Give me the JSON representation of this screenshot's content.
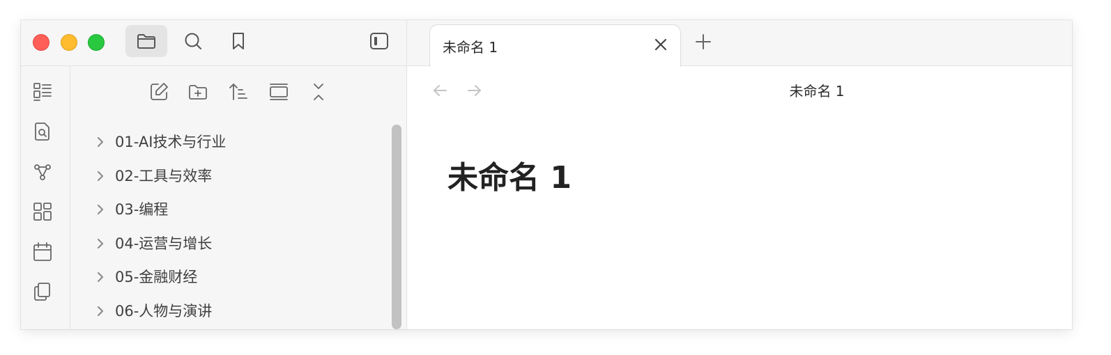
{
  "sidebar": {
    "top_buttons": [
      {
        "name": "file-explorer",
        "icon": "folder-icon",
        "active": true
      },
      {
        "name": "search",
        "icon": "search-icon",
        "active": false
      },
      {
        "name": "bookmarks",
        "icon": "bookmark-icon",
        "active": false
      }
    ],
    "toggle_icon": "sidebar-toggle-icon",
    "ribbon_icons": [
      "document-list-icon",
      "file-search-icon",
      "graph-icon",
      "canvas-icon",
      "calendar-icon",
      "copy-icon"
    ],
    "explorer_actions": [
      "new-note-icon",
      "new-folder-icon",
      "sort-icon",
      "collapse-view-icon",
      "collapse-all-icon"
    ],
    "folders": [
      {
        "label": "01-AI技术与行业"
      },
      {
        "label": "02-工具与效率"
      },
      {
        "label": "03-编程"
      },
      {
        "label": "04-运营与增长"
      },
      {
        "label": "05-金融财经"
      },
      {
        "label": "06-人物与演讲"
      }
    ]
  },
  "tabs": [
    {
      "title": "未命名 1",
      "active": true
    }
  ],
  "view": {
    "title": "未命名 1",
    "heading": "未命名 1"
  },
  "colors": {
    "close": "#ff5f57",
    "minimize": "#febc2e",
    "maximize": "#28c840"
  }
}
